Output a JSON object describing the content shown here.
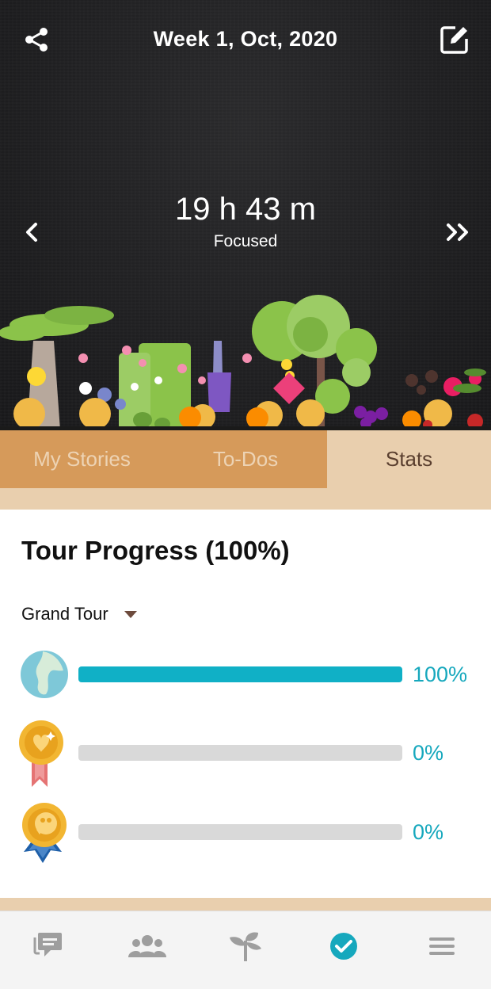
{
  "header": {
    "week_title": "Week 1, Oct, 2020",
    "focus_time": "19 h 43 m",
    "focus_label": "Focused",
    "share_icon": "share-icon",
    "edit_icon": "edit-icon",
    "prev_icon": "chevron-left-icon",
    "next_icon": "double-chevron-right-icon"
  },
  "tabs": [
    {
      "label": "My Stories",
      "active": false
    },
    {
      "label": "To-Dos",
      "active": false
    },
    {
      "label": "Stats",
      "active": true
    }
  ],
  "tour": {
    "title": "Tour Progress (100%)",
    "selector_value": "Grand Tour",
    "items": [
      {
        "icon": "globe-icon",
        "progress": 100,
        "label": "100%"
      },
      {
        "icon": "gold-medal-icon",
        "progress": 0,
        "label": "0%"
      },
      {
        "icon": "blue-medal-icon",
        "progress": 0,
        "label": "0%"
      }
    ]
  },
  "bottom_nav": [
    {
      "icon": "chat-icon"
    },
    {
      "icon": "friends-icon"
    },
    {
      "icon": "plant-icon"
    },
    {
      "icon": "checkmark-circle-icon",
      "active": true
    },
    {
      "icon": "menu-icon"
    }
  ],
  "colors": {
    "accent": "#10b0c6",
    "tab_bg": "#d69a5a",
    "tab_active_bg": "#e9cfae",
    "hero_bg": "#1d1d1f"
  }
}
